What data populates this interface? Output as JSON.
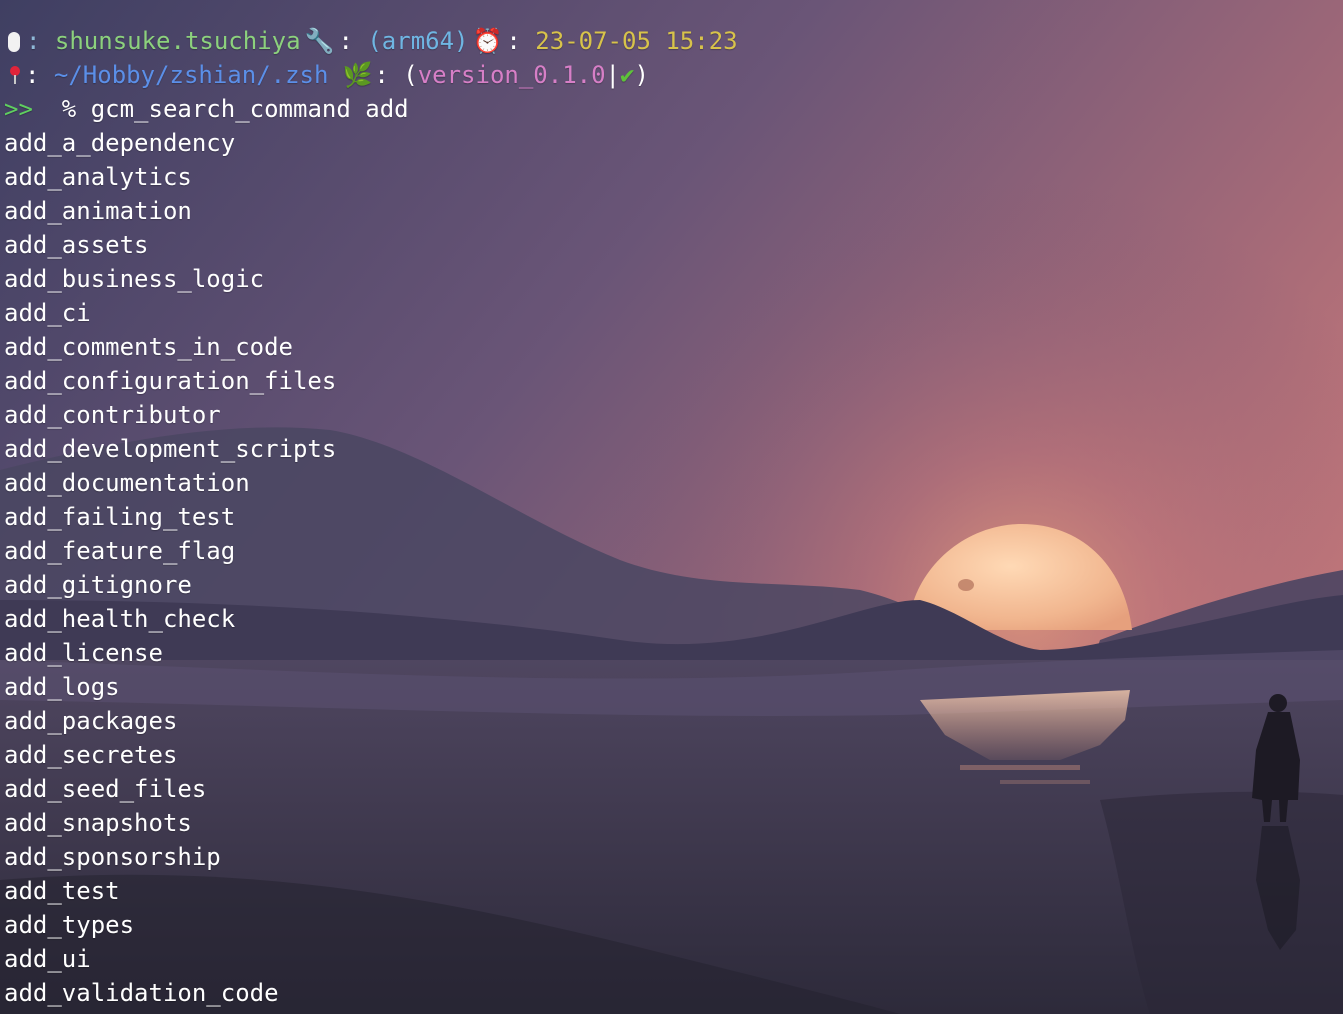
{
  "prompt": {
    "line1": {
      "sep1": ": ",
      "user": "shunsuke.tsuchiya",
      "sep2": ": ",
      "arch": "(arm64)",
      "sep3": ": ",
      "datetime": "23-07-05 15:23"
    },
    "line2": {
      "sep1": ": ",
      "path": "~/Hobby/zshian/.zsh",
      "sep2": ": ",
      "branch_open": "(",
      "branch": "version_0.1.0",
      "branch_bar": "|",
      "branch_close": ")"
    },
    "input": {
      "arrow": ">>",
      "command": "  % gcm_search_command add"
    },
    "icons": {
      "line1_left": "mouse-icon",
      "line1_mid": "wrench-icon",
      "line1_right": "alarm-clock-icon",
      "line2_left": "pin-icon",
      "line2_mid": "herb-icon",
      "branch_status": "check-icon"
    },
    "colors": {
      "user": "#8cd17d",
      "arch": "#6fb6e3",
      "datetime": "#d8c34a",
      "path": "#5b8fe8",
      "branch": "#d77fc7",
      "prompt_arrow": "#5fcf5f"
    }
  },
  "output": [
    "add_a_dependency",
    "add_analytics",
    "add_animation",
    "add_assets",
    "add_business_logic",
    "add_ci",
    "add_comments_in_code",
    "add_configuration_files",
    "add_contributor",
    "add_development_scripts",
    "add_documentation",
    "add_failing_test",
    "add_feature_flag",
    "add_gitignore",
    "add_health_check",
    "add_license",
    "add_logs",
    "add_packages",
    "add_secretes",
    "add_seed_files",
    "add_snapshots",
    "add_sponsorship",
    "add_test",
    "add_types",
    "add_ui",
    "add_validation_code"
  ]
}
